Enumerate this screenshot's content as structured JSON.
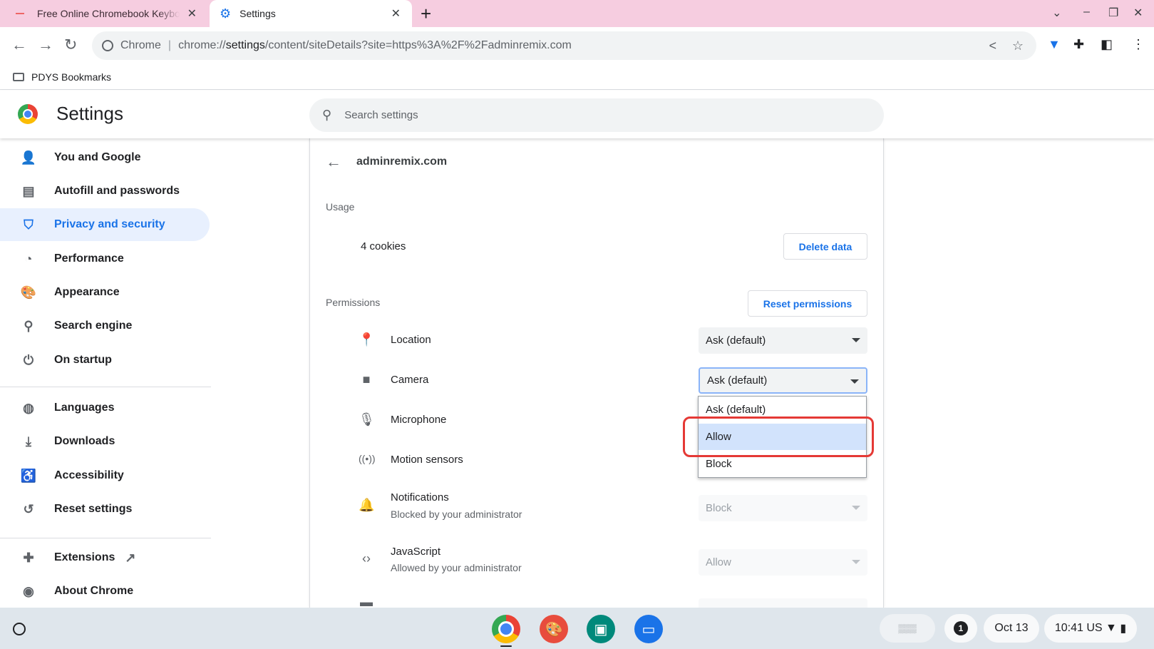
{
  "browser": {
    "tabs": [
      {
        "title": "Free Online Chromebook Keyboard",
        "close": "✕"
      },
      {
        "title": "Settings",
        "close": "✕"
      }
    ],
    "new_tab": "+",
    "omnibox": {
      "prefix": "Chrome",
      "separator": "|",
      "url_scheme": "chrome://",
      "url_host": "settings",
      "url_rest": "/content/siteDetails?site=https%3A%2F%2Fadminremix.com"
    },
    "bookmarks": [
      {
        "label": "PDYS Bookmarks"
      }
    ]
  },
  "settings": {
    "title": "Settings",
    "search": {
      "placeholder": "Search settings"
    }
  },
  "sidebar": {
    "items": [
      {
        "label": "You and Google",
        "icon": "person-icon"
      },
      {
        "label": "Autofill and passwords",
        "icon": "clipboard-icon"
      },
      {
        "label": "Privacy and security",
        "icon": "shield-icon",
        "active": true
      },
      {
        "label": "Performance",
        "icon": "gauge-icon"
      },
      {
        "label": "Appearance",
        "icon": "palette-icon"
      },
      {
        "label": "Search engine",
        "icon": "search-icon"
      },
      {
        "label": "On startup",
        "icon": "power-icon"
      },
      {
        "label": "Languages",
        "icon": "globe-icon"
      },
      {
        "label": "Downloads",
        "icon": "download-icon"
      },
      {
        "label": "Accessibility",
        "icon": "accessibility-icon"
      },
      {
        "label": "Reset settings",
        "icon": "history-icon"
      },
      {
        "label": "Extensions",
        "icon": "puzzle-icon"
      },
      {
        "label": "About Chrome",
        "icon": "chrome-icon"
      }
    ]
  },
  "site": {
    "name": "adminremix.com",
    "usage_label": "Usage",
    "cookies": "4 cookies",
    "delete_button": "Delete data",
    "permissions_label": "Permissions",
    "reset_button": "Reset permissions",
    "permissions": [
      {
        "name": "Location",
        "value": "Ask (default)"
      },
      {
        "name": "Camera",
        "value": "Ask (default)"
      },
      {
        "name": "Microphone",
        "value": ""
      },
      {
        "name": "Motion sensors",
        "value": ""
      },
      {
        "name": "Notifications",
        "sub": "Blocked by your administrator",
        "value": "Block"
      },
      {
        "name": "JavaScript",
        "sub": "Allowed by your administrator",
        "value": "Allow"
      }
    ],
    "dropdown_options": [
      "Ask (default)",
      "Allow",
      "Block"
    ],
    "dropdown_selected": "Allow"
  },
  "shelf": {
    "notification_count": "1",
    "date": "Oct 13",
    "time": "10:41",
    "locale": "US"
  },
  "colors": {
    "tabstrip": "#f6cde0",
    "accent": "#1a73e8",
    "highlight_box": "#e53935",
    "selected_option": "#d2e3fc"
  }
}
